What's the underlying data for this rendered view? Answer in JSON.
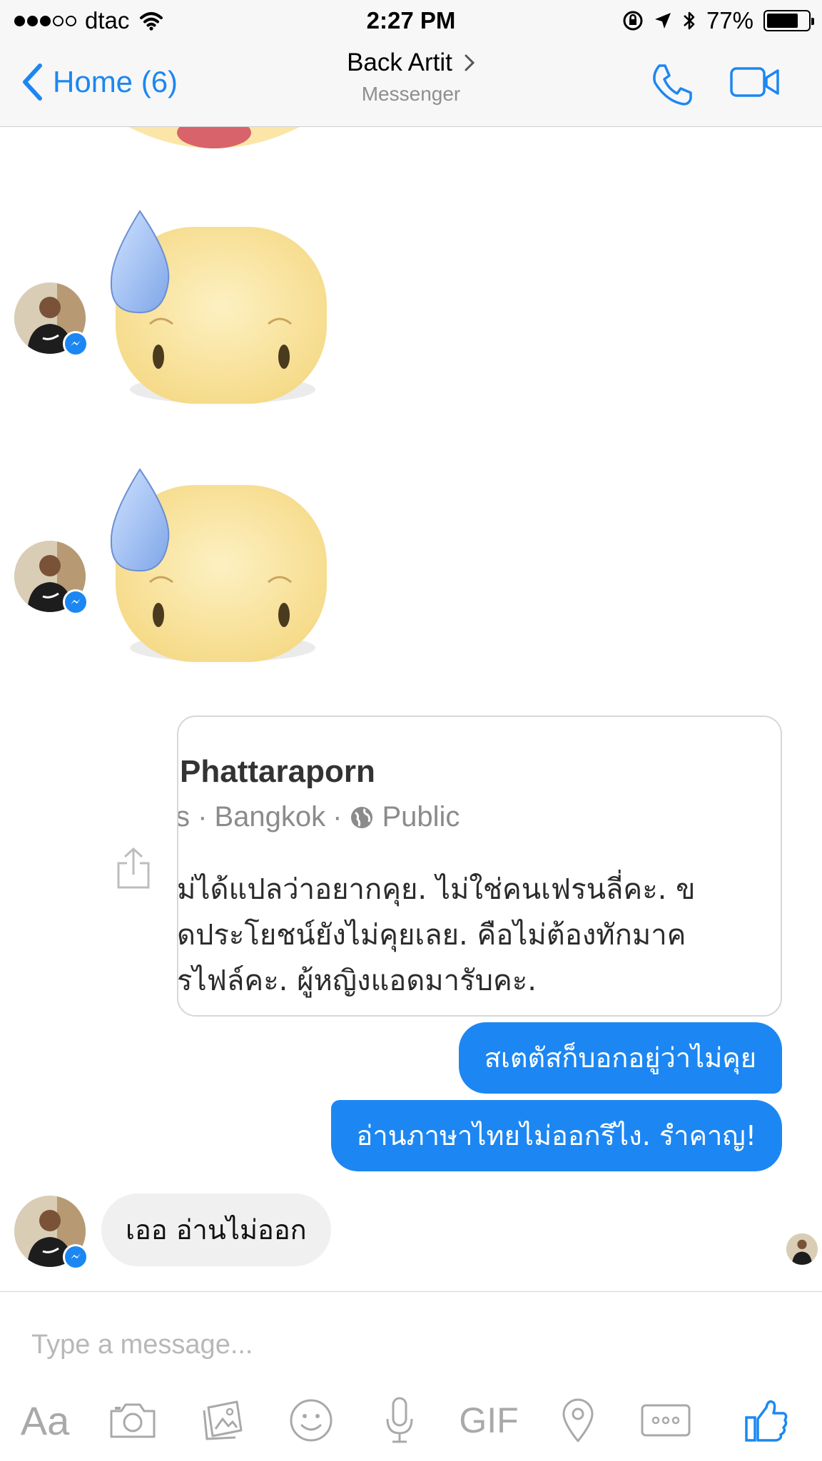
{
  "status_bar": {
    "carrier": "dtac",
    "time": "2:27 PM",
    "battery": "77%",
    "battery_level": 0.77
  },
  "nav": {
    "back_label": "Home (6)",
    "title": "Back Artit",
    "subtitle": "Messenger"
  },
  "link_card": {
    "title": "Phattaraporn",
    "meta": {
      "lead": "s ·",
      "location": "Bangkok",
      "separator": "·",
      "privacy": "Public"
    },
    "body_lines": [
      "ม่ได้แปลว่าอยากคุย. ไม่ใช่คนเฟรนลี่คะ. ข",
      "ิดประโยชน์ยังไม่คุยเลย. คือไม่ต้องทักมาค",
      "รไฟล์คะ. ผู้หญิงแอดมารับคะ."
    ]
  },
  "messages": {
    "outgoing": [
      "สเตตัสก็บอกอยู่ว่าไม่คุย",
      "อ่านภาษาไทยไม่ออกรึไง. รำคาญ!"
    ],
    "incoming": "เออ อ่านไม่ออก"
  },
  "composer": {
    "placeholder": "Type a message...",
    "aa_label": "Aa",
    "gif_label": "GIF"
  },
  "colors": {
    "accent": "#1c87f2",
    "bubble_in": "#f0f0f0",
    "icon_gray": "#a9a9a9"
  }
}
